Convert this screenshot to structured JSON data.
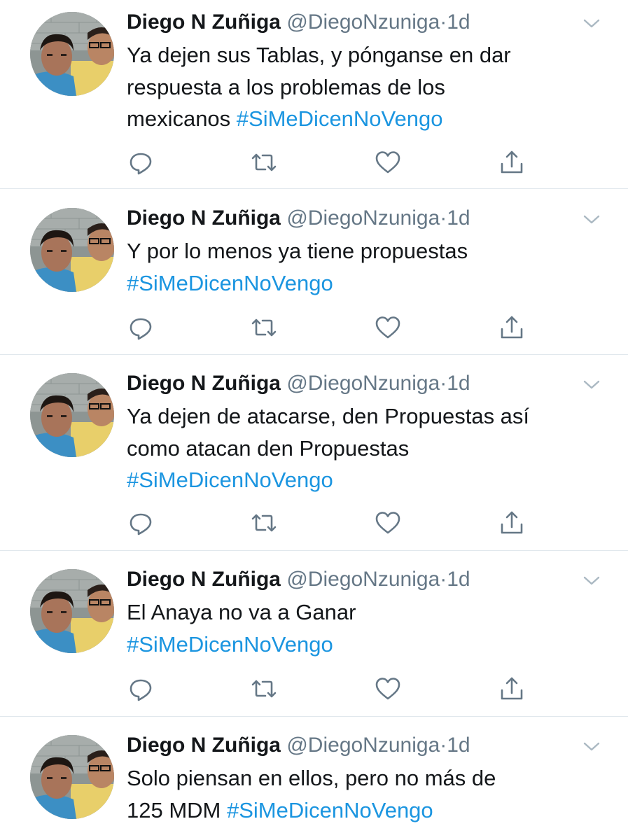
{
  "colors": {
    "text": "#14171a",
    "muted": "#657786",
    "hashtag": "#1b95e0",
    "divider": "#e1e8ed"
  },
  "icons": {
    "reply": "reply-icon",
    "retweet": "retweet-icon",
    "like": "heart-icon",
    "share": "share-icon",
    "menu": "chevron-down-icon",
    "avatar": "profile-photo"
  },
  "tweets": [
    {
      "name": "Diego N Zuñiga",
      "handle": "@DiegoNzuniga",
      "dot": "·",
      "time": "1d",
      "line1": "Ya dejen sus Tablas, y pónganse en dar",
      "line2": "respuesta a los problemas de los",
      "line3_prefix": "mexicanos ",
      "hashtag": "#SiMeDicenNoVengo"
    },
    {
      "name": "Diego N Zuñiga",
      "handle": "@DiegoNzuniga",
      "dot": "·",
      "time": "1d",
      "line1": "Y por lo menos ya tiene propuestas",
      "hashtag": "#SiMeDicenNoVengo"
    },
    {
      "name": "Diego N Zuñiga",
      "handle": "@DiegoNzuniga",
      "dot": "·",
      "time": "1d",
      "line1": "Ya dejen de atacarse, den Propuestas así",
      "line2": "como atacan den Propuestas",
      "hashtag": "#SiMeDicenNoVengo"
    },
    {
      "name": "Diego N Zuñiga",
      "handle": "@DiegoNzuniga",
      "dot": "·",
      "time": "1d",
      "line1": "El Anaya no va a Ganar",
      "hashtag": "#SiMeDicenNoVengo"
    },
    {
      "name": "Diego N Zuñiga",
      "handle": "@DiegoNzuniga",
      "dot": "·",
      "time": "1d",
      "line1": "Solo piensan en ellos, pero no más de",
      "line2_prefix": "125 MDM ",
      "hashtag": "#SiMeDicenNoVengo"
    }
  ]
}
